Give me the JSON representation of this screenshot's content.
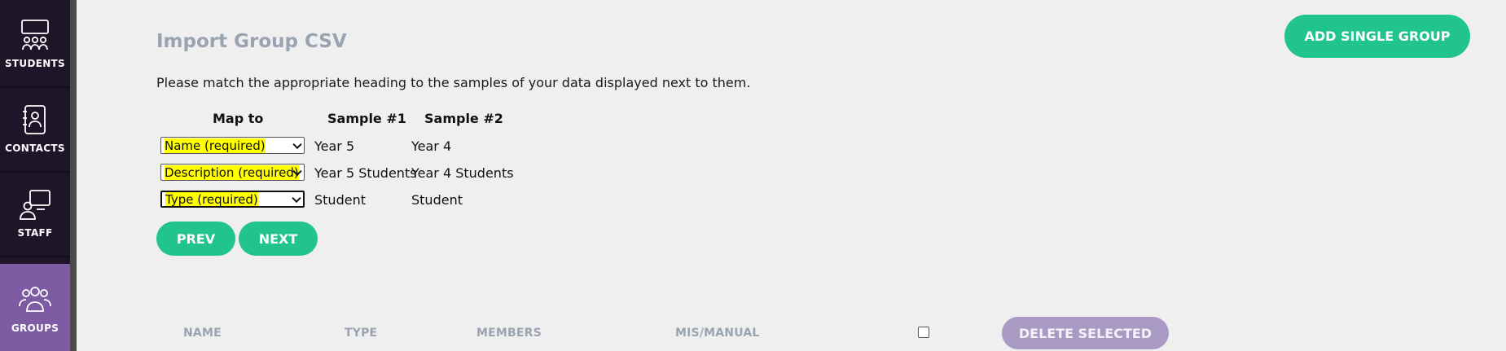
{
  "sidebar": {
    "items": [
      {
        "label": "STUDENTS",
        "icon": "students-icon"
      },
      {
        "label": "CONTACTS",
        "icon": "contacts-icon"
      },
      {
        "label": "STAFF",
        "icon": "staff-icon"
      },
      {
        "label": "GROUPS",
        "icon": "groups-icon",
        "active": true
      }
    ],
    "active_color": "#7d5ca3",
    "background_color": "#1f1528"
  },
  "header": {
    "title": "Import Group CSV",
    "add_button_label": "ADD SINGLE GROUP"
  },
  "import": {
    "intro": "Please match the appropriate heading to the samples of your data displayed next to them.",
    "columns": [
      "Map to",
      "Sample #1",
      "Sample #2"
    ],
    "rows": [
      {
        "mapping": "Name (required)",
        "sample1": "Year 5",
        "sample2": "Year 4"
      },
      {
        "mapping": "Description (required)",
        "sample1": "Year 5 Students",
        "sample2": "Year 4 Students"
      },
      {
        "mapping": "Type (required)",
        "sample1": "Student",
        "sample2": "Student"
      }
    ],
    "prev_label": "PREV",
    "next_label": "NEXT"
  },
  "group_list": {
    "headers": [
      "NAME",
      "TYPE",
      "MEMBERS",
      "MIS/MANUAL"
    ],
    "delete_label": "DELETE SELECTED"
  },
  "colors": {
    "accent": "#21c48c",
    "highlight": "#ffff00",
    "muted_text": "#9aa3b0",
    "delete_button": "#a99ac4"
  }
}
